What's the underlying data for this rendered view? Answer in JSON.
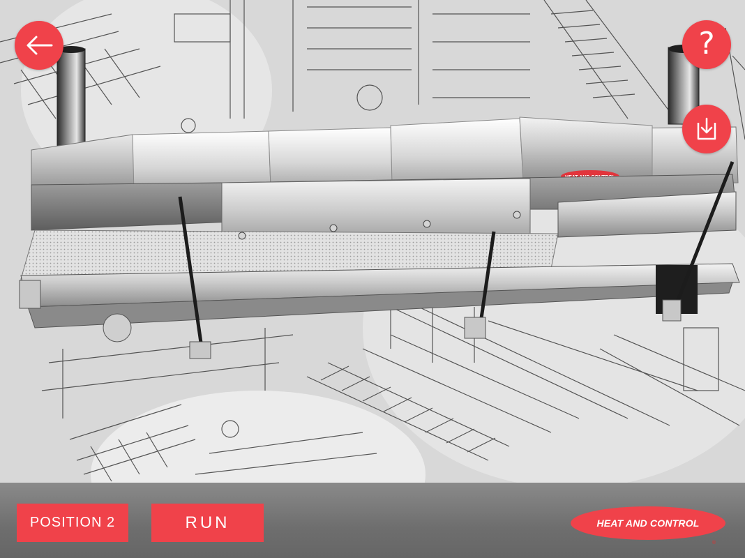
{
  "colors": {
    "accent": "#f0424a",
    "bar_background": "#6e6e6e",
    "machine_steel": "#b8b8b8"
  },
  "overlay": {
    "back_button": {
      "icon": "arrow-left-icon"
    },
    "help_button": {
      "icon": "question-mark-icon",
      "glyph": "?"
    },
    "download_button": {
      "icon": "download-icon"
    }
  },
  "scene": {
    "machine_badge": "HEAT AND CONTROL"
  },
  "bottom_bar": {
    "position_label": "POSITION 2",
    "run_label": "RUN",
    "logo_text": "HEAT AND CONTROL",
    "logo_mark": "®"
  }
}
